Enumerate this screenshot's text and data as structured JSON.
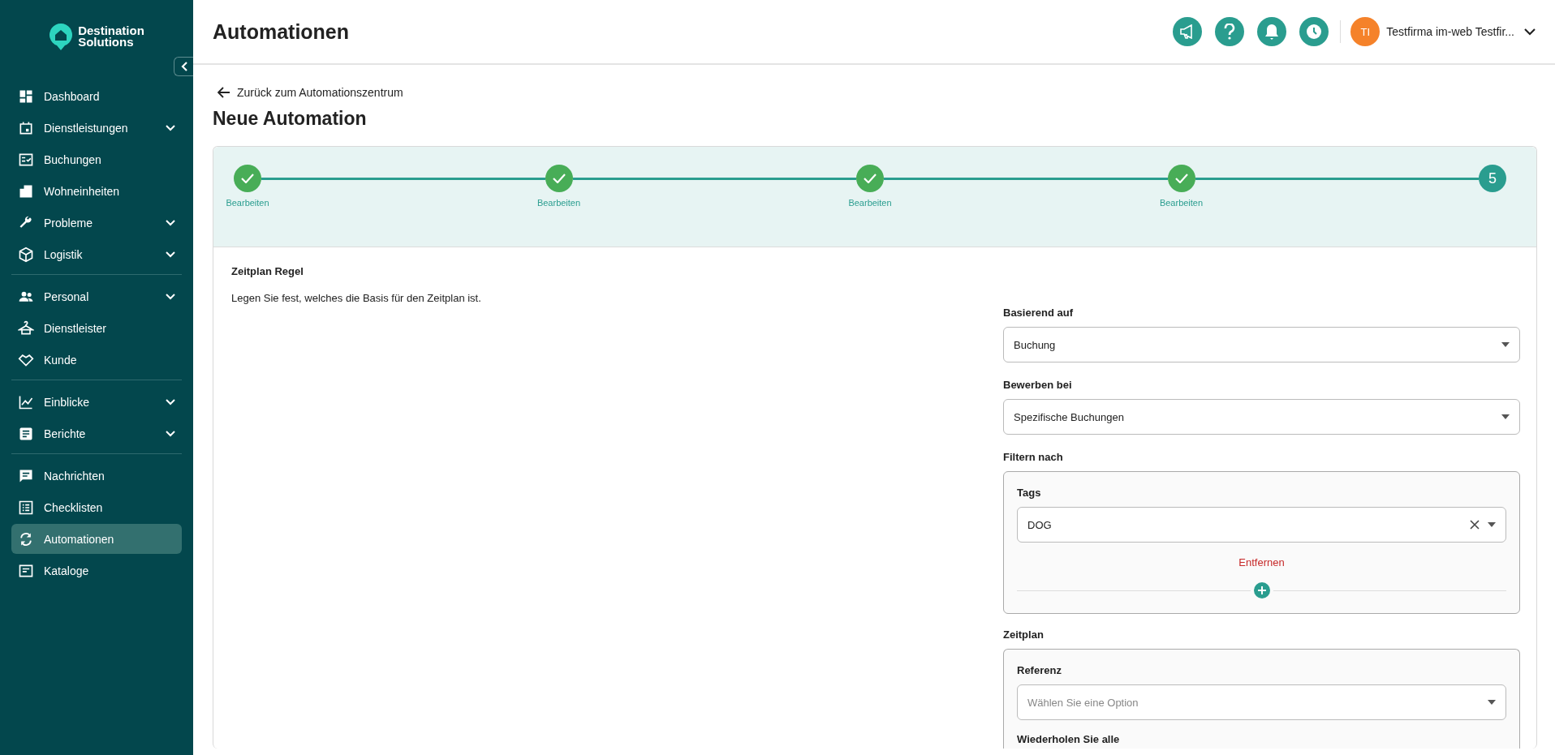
{
  "brand": {
    "line_1": "Destination",
    "line_2": "Solutions"
  },
  "sidebar": {
    "groups": [
      {
        "items": [
          {
            "label": "Dashboard",
            "expandable": false,
            "selected": false
          },
          {
            "label": "Dienstleistungen",
            "expandable": true,
            "selected": false
          },
          {
            "label": "Buchungen",
            "expandable": false,
            "selected": false
          },
          {
            "label": "Wohneinheiten",
            "expandable": false,
            "selected": false
          },
          {
            "label": "Probleme",
            "expandable": true,
            "selected": false
          },
          {
            "label": "Logistik",
            "expandable": true,
            "selected": false
          }
        ]
      },
      {
        "items": [
          {
            "label": "Personal",
            "expandable": true,
            "selected": false
          },
          {
            "label": "Dienstleister",
            "expandable": false,
            "selected": false
          },
          {
            "label": "Kunde",
            "expandable": false,
            "selected": false
          }
        ]
      },
      {
        "items": [
          {
            "label": "Einblicke",
            "expandable": true,
            "selected": false
          },
          {
            "label": "Berichte",
            "expandable": true,
            "selected": false
          }
        ]
      },
      {
        "items": [
          {
            "label": "Nachrichten",
            "expandable": false,
            "selected": false
          },
          {
            "label": "Checklisten",
            "expandable": false,
            "selected": false
          },
          {
            "label": "Automationen",
            "expandable": false,
            "selected": true
          },
          {
            "label": "Kataloge",
            "expandable": false,
            "selected": false
          }
        ]
      }
    ]
  },
  "header": {
    "title": "Automationen",
    "user": {
      "initials": "TI",
      "name": "Testfirma im-web Testfir..."
    }
  },
  "back_link": "Zurück zum Automationszentrum",
  "page_title": "Neue Automation",
  "stepper": [
    {
      "done": true,
      "label": "Bearbeiten"
    },
    {
      "done": true,
      "label": "Bearbeiten"
    },
    {
      "done": true,
      "label": "Bearbeiten"
    },
    {
      "done": true,
      "label": "Bearbeiten"
    },
    {
      "done": false,
      "number": "5"
    }
  ],
  "section": {
    "title": "Zeitplan Regel",
    "description": "Legen Sie fest, welches die Basis für den Zeitplan ist."
  },
  "form": {
    "based_on": {
      "label": "Basierend auf",
      "value": "Buchung"
    },
    "apply_to": {
      "label": "Bewerben bei",
      "value": "Spezifische Buchungen"
    },
    "filter": {
      "label": "Filtern nach",
      "field_label": "Tags",
      "value": "DOG",
      "remove": "Entfernen"
    },
    "schedule": {
      "label": "Zeitplan",
      "reference_label": "Referenz",
      "reference_placeholder": "Wählen Sie eine Option",
      "repeat_label": "Wiederholen Sie alle"
    }
  }
}
